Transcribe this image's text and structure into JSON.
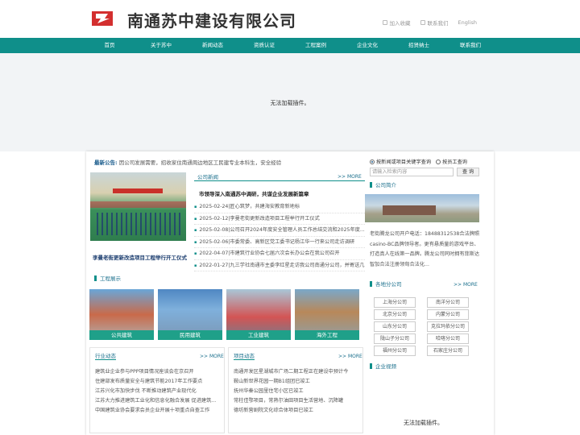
{
  "header": {
    "company_name": "南通苏中建设有限公司",
    "links": [
      "加入收藏",
      "联系我们",
      "English"
    ]
  },
  "nav": [
    "首页",
    "关于苏中",
    "新闻动态",
    "资质认证",
    "工程案例",
    "企业文化",
    "招贤纳士",
    "联系我们"
  ],
  "banner_message": "无法加载插件。",
  "notice": {
    "label": "最新公告:",
    "text": "因公司发展需要，招收家住南通周边地区工民建专业本科生，安全经验"
  },
  "news": {
    "title": "公司新闻",
    "more": ">> MORE",
    "headline": "市领导深入南通苏中调研，共谋企业发展新篇章",
    "image_caption": "李曼老街更新改造项目工程举行开工仪式",
    "items": [
      "2025-02-24|匠心筑梦，共建海安教育新地标",
      "2025-02-12|李曼老街更新改造项目工程举行开工仪式",
      "2025-02-08|公司召开2024年度安全管理人员工作总结交流和2025年度...",
      "2025-02-06|市委常委、高新区党工委书记杨江华一行来公司走访调研",
      "2022-04-07|市建筑行业协会七届六次会长办公会在我公司召开",
      "2022-01-27|九三学社南通市主委李红星走访我公司南通分公司，并寄送几三"
    ]
  },
  "cases": {
    "title": "工程展示",
    "items": [
      "公共建筑",
      "民用建筑",
      "工业建筑",
      "海外工程"
    ]
  },
  "industry": {
    "title": "行业动态",
    "more": ">> MORE",
    "items": [
      "建筑业企业参与PPP项目情况座谈会在京召开",
      "住建部发布质量安全与建筑节能2017年工作要点",
      "江苏兴化市加快步伐 不断推动建筑产业现代化",
      "江苏大力推进建筑工业化和信息化融合发展 促进建筑...",
      "中国建筑业协会要求会员企业开展十项重点自查工作"
    ]
  },
  "projects": {
    "title": "项目动态",
    "more": ">> MORE",
    "items": [
      "南通开发区星湖城市广场二期工程正在建设中预计今",
      "鞍山新世界花园一期B1组团已竣工",
      "抚州华秦公园里住宅小区已竣工",
      "常柱佳鄂项目，常熟尔油田项目生活营地、沉降罐",
      "德坊新营剧院文化综合体项目已竣工"
    ]
  },
  "search": {
    "options": [
      "按新闻或项目关键字查询",
      "按员工查询"
    ],
    "placeholder": "请输入检索内容",
    "button": "查 询"
  },
  "intro": {
    "title": "公司简介",
    "text": "老街腾龙公司开户电话：18488312538合法牌照casino-BC品牌领导者。更有悬质量的游戏平台、打造真人在线第一品牌。腾龙公司同时拥有菲斯达智加合法注册领匈合法化..."
  },
  "branches": {
    "title": "各地分公司",
    "more": ">> MORE",
    "items": [
      "上海分公司",
      "南洋分公司",
      "北京分公司",
      "内蒙分公司",
      "山东分公司",
      "克拉玛依分公司",
      "陇山子分公司",
      "哈喀分公司",
      "福州分公司",
      "石家庄分公司"
    ]
  },
  "video": {
    "title": "企业视频",
    "message": "无法加载插件。"
  },
  "colors": {
    "primary": "#0f8f8a",
    "link": "#1a6f8c",
    "logo_red": "#d32f2f"
  }
}
